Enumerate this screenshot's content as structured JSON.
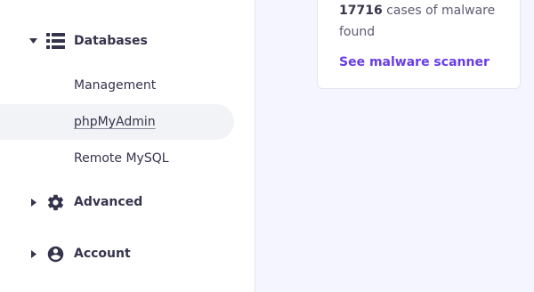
{
  "sidebar": {
    "databases": {
      "label": "Databases",
      "icon": "database-list-icon",
      "expanded": true,
      "items": [
        {
          "label": "Management",
          "active": false
        },
        {
          "label": "phpMyAdmin",
          "active": true
        },
        {
          "label": "Remote MySQL",
          "active": false
        }
      ]
    },
    "advanced": {
      "label": "Advanced",
      "icon": "gear-icon",
      "expanded": false
    },
    "account": {
      "label": "Account",
      "icon": "account-circle-icon",
      "expanded": false
    }
  },
  "malware_card": {
    "count": "17716",
    "description": " cases of malware found",
    "link_label": "See malware scanner"
  },
  "colors": {
    "accent": "#673de6",
    "sidebar_text": "#36344d",
    "main_bg": "#f4f5ff",
    "active_item_bg": "#f2f3f6"
  }
}
